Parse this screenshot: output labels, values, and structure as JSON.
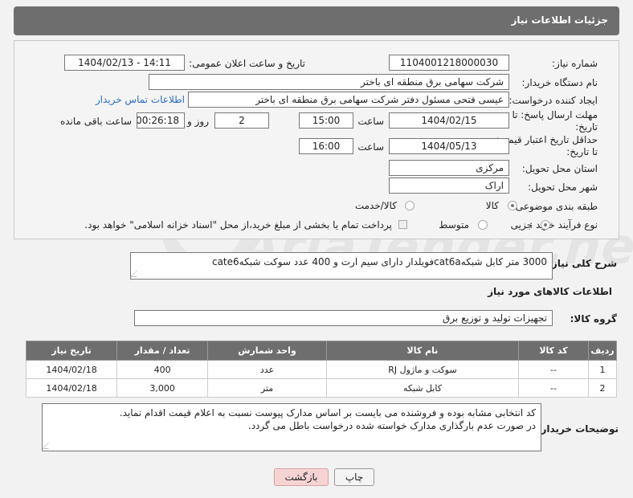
{
  "page": {
    "title": "جزئیات اطلاعات نیاز"
  },
  "fields": {
    "need_number_label": "شماره نیاز:",
    "need_number": "1104001218000030",
    "announce_label": "تاریخ و ساعت اعلان عمومی:",
    "announce_value": "1404/02/13 - 14:11",
    "buyer_org_label": "نام دستگاه خریدار:",
    "buyer_org": "شرکت سهامی برق منطقه ای باختر",
    "creator_label": "ایجاد کننده درخواست:",
    "creator": "عیسی فتحی مسئول دفتر شرکت سهامی برق منطقه ای باختر",
    "contact_link": "اطلاعات تماس خریدار",
    "reply_deadline_label": "مهلت ارسال پاسخ: تا تاریخ:",
    "reply_date": "1404/02/15",
    "time_word": "ساعت",
    "reply_time": "15:00",
    "days": "2",
    "days_word": "روز و",
    "remaining": "00:26:18",
    "remaining_word": "ساعت باقی مانده",
    "price_validity_label": "حداقل تاریخ اعتبار قیمت: تا تاریخ:",
    "price_date": "1404/05/13",
    "price_time": "16:00",
    "province_label": "استان محل تحویل:",
    "province": "مرکزی",
    "city_label": "شهر محل تحویل:",
    "city": "اراک",
    "category_label": "طبقه بندی موضوعی:",
    "category_options": [
      "کالا",
      "کالا/خدمت"
    ],
    "process_label": "نوع فرآیند خرید :",
    "process_options": [
      "جزیی",
      "متوسط"
    ],
    "payment_note": "پرداخت تمام یا بخشی از مبلغ خرید،از محل \"اسناد خزانه اسلامی\" خواهد بود."
  },
  "summary": {
    "label": "شرح کلی نیاز:",
    "text": "3000 متر کابل شبکهcat6aفویلدار دارای سیم ارت و 400 عدد سوکت شبکهcate6"
  },
  "goods": {
    "section_title": "اطلاعات کالاهای مورد نیاز",
    "group_label": "گروه کالا:",
    "group_value": "تجهیزات تولید و توزیع برق",
    "columns": [
      "ردیف",
      "کد کالا",
      "نام کالا",
      "واحد شمارش",
      "تعداد / مقدار",
      "تاریخ نیاز"
    ],
    "rows": [
      [
        "1",
        "--",
        "سوکت و ماژول RJ",
        "عدد",
        "400",
        "1404/02/18"
      ],
      [
        "2",
        "--",
        "کابل شبکه",
        "متر",
        "3,000",
        "1404/02/18"
      ]
    ]
  },
  "buyer_notes": {
    "label": "توضیحات خریدار:",
    "line1": "کد انتخابی مشابه بوده و فروشنده می بایست بر اساس مدارک پیوست نسبت به اعلام قیمت اقدام نماید.",
    "line2": "در صورت عدم بارگذاری مدارک خواسته شده درخواست باطل می گردد."
  },
  "buttons": {
    "print": "چاپ",
    "back": "بازگشت"
  },
  "watermark": "AriaTender.net"
}
